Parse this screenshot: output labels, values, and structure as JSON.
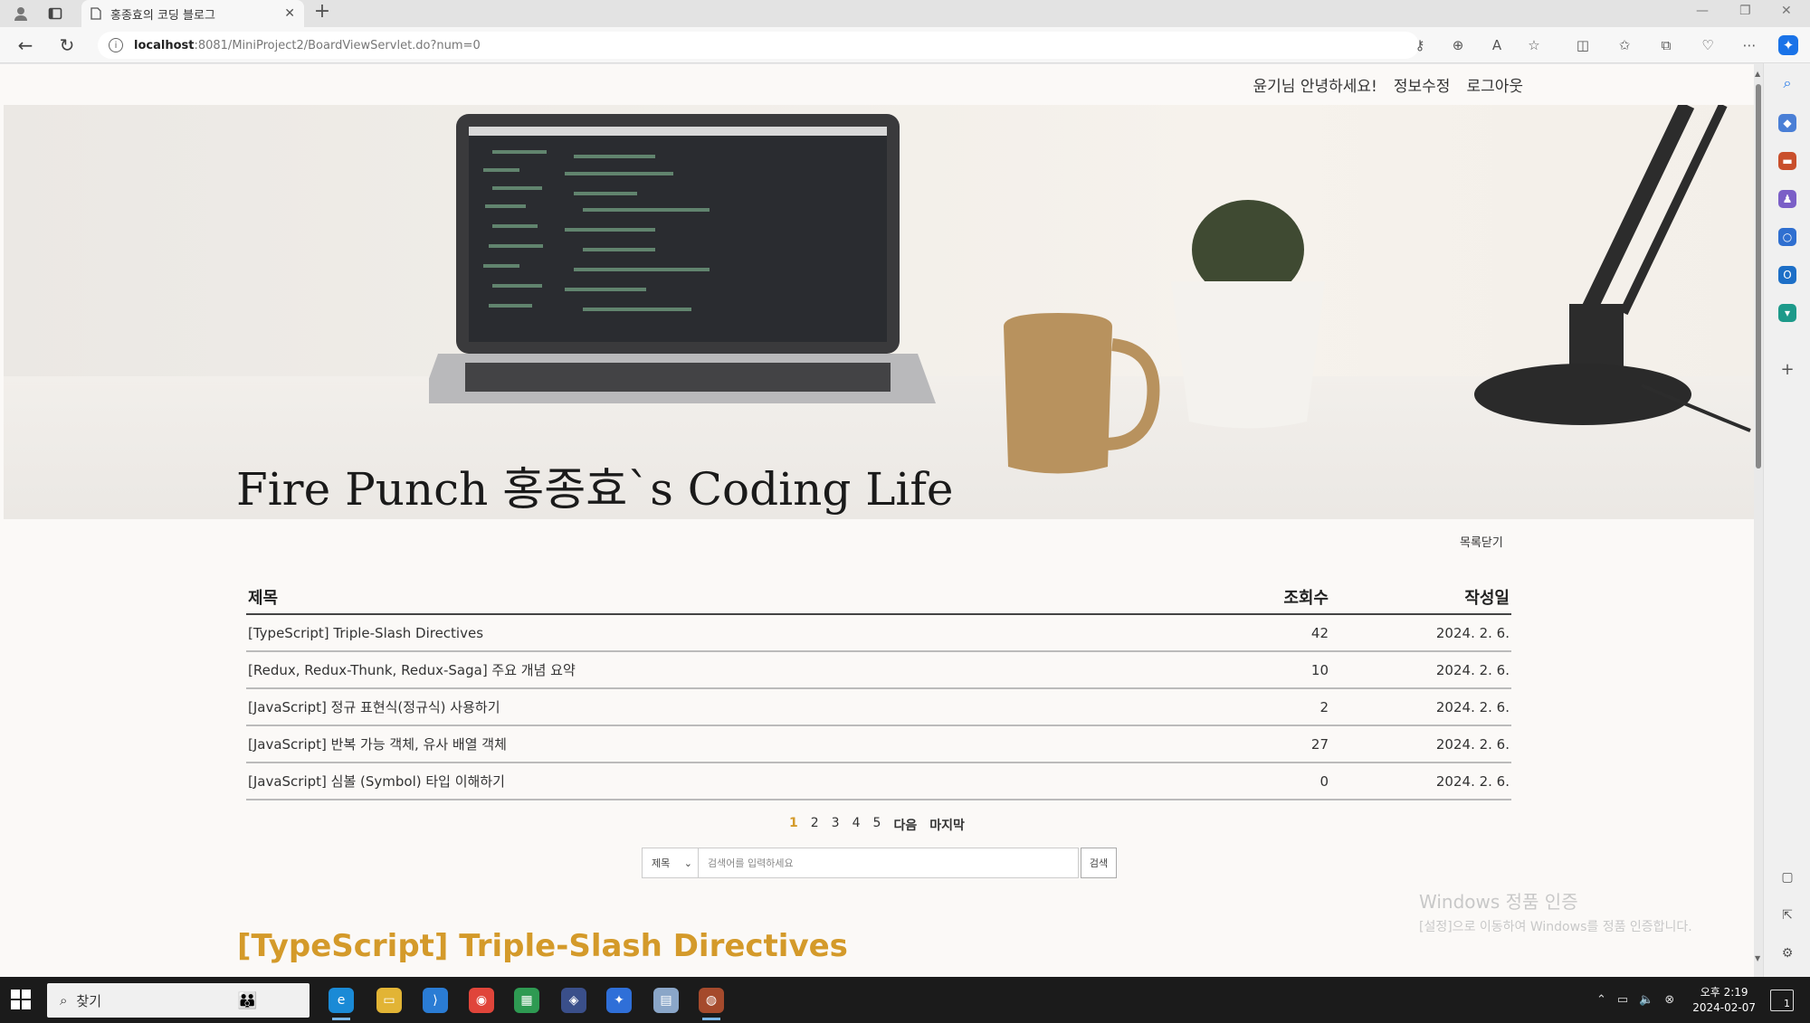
{
  "browser": {
    "tab_title": "홍종효의 코딩 블로그",
    "new_tab_glyph": "+",
    "url_host": "localhost",
    "url_rest": ":8081/MiniProject2/BoardViewServlet.do?num=0"
  },
  "page": {
    "nav": {
      "greeting": "윤기님 안녕하세요!",
      "edit_profile": "정보수정",
      "logout": "로그아웃"
    },
    "hero": {
      "title": "Fire Punch 홍종효`s Coding Life"
    },
    "close_list": "목록닫기",
    "table": {
      "headers": {
        "title": "제목",
        "views": "조회수",
        "date": "작성일"
      },
      "rows": [
        {
          "title": "[TypeScript] Triple-Slash Directives",
          "views": "42",
          "date": "2024. 2. 6."
        },
        {
          "title": "[Redux, Redux-Thunk, Redux-Saga] 주요 개념 요약",
          "views": "10",
          "date": "2024. 2. 6."
        },
        {
          "title": "[JavaScript] 정규 표현식(정규식) 사용하기",
          "views": "2",
          "date": "2024. 2. 6."
        },
        {
          "title": "[JavaScript] 반복 가능 객체, 유사 배열 객체",
          "views": "27",
          "date": "2024. 2. 6."
        },
        {
          "title": "[JavaScript] 심볼 (Symbol) 타입 이해하기",
          "views": "0",
          "date": "2024. 2. 6."
        }
      ]
    },
    "pagination": {
      "pages": [
        "1",
        "2",
        "3",
        "4",
        "5"
      ],
      "next": "다음",
      "last": "마지막"
    },
    "search": {
      "select_value": "제목",
      "placeholder": "검색어를 입력하세요",
      "button": "검색"
    },
    "post_title": "[TypeScript] Triple-Slash Directives"
  },
  "watermark": {
    "line1": "Windows 정품 인증",
    "line2": "[설정]으로 이동하여 Windows를 정품 인증합니다."
  },
  "taskbar": {
    "search_label": "찾기",
    "time": "오후 2:19",
    "date": "2024-02-07",
    "notifications": "1"
  },
  "colors": {
    "accent": "#d49a2a",
    "taskbar": "#1b1b1b"
  }
}
